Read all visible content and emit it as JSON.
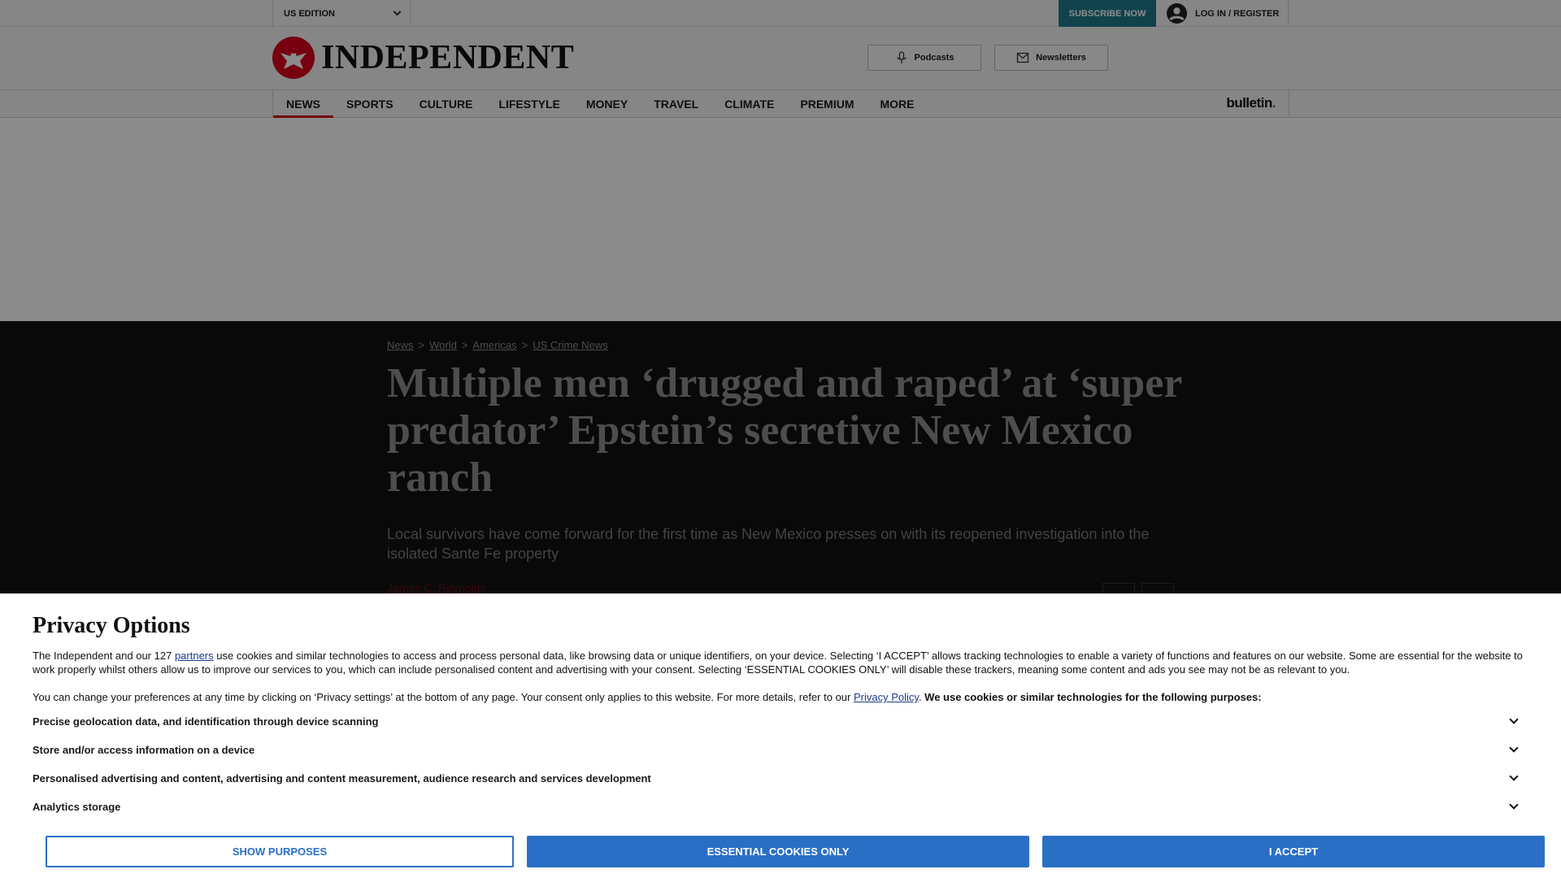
{
  "topbar": {
    "edition": "US EDITION",
    "subscribe": "SUBSCRIBE NOW",
    "login": "LOG IN / REGISTER"
  },
  "masthead": {
    "logo_text": "INDEPENDENT",
    "podcasts": "Podcasts",
    "newsletters": "Newsletters"
  },
  "nav": {
    "items": [
      "NEWS",
      "SPORTS",
      "CULTURE",
      "LIFESTYLE",
      "MONEY",
      "TRAVEL",
      "CLIMATE",
      "PREMIUM",
      "MORE"
    ],
    "active": "NEWS",
    "bulletin": "bulletin",
    "bulletin_dot": "."
  },
  "article": {
    "breadcrumbs": [
      "News",
      "World",
      "Americas",
      "US Crime News"
    ],
    "separator": ">",
    "headline": "Multiple men ‘drugged and raped’ at ‘super predator’ Epstein’s secretive New Mexico ranch",
    "standfirst": "Local survivors have come forward for the first time as New Mexico presses on with its reopened investigation into the isolated Sante Fe property",
    "author": "James C. Reynolds"
  },
  "privacy": {
    "title": "Privacy Options",
    "p1_before": "The Independent and our 127 ",
    "p1_link": "partners",
    "p1_after": " use cookies and similar technologies to access and process personal data, like browsing data or unique identifiers, on your device. Selecting ‘I ACCEPT’ allows tracking technologies to enable a variety of functions and features on our website. Some are essential for the website to work properly whilst others allow us to improve our services to you, which can include personalised content and advertising with your consent. Selecting ‘ESSENTIAL COOKIES ONLY’ will disable these trackers, meaning some content and ads you see may not be as relevant to you.",
    "p2_before": "You can change your preferences at any time by clicking on ‘Privacy settings’ at the bottom of any page. Your consent only applies to this website. For more details, refer to our ",
    "p2_link": "Privacy Policy",
    "p2_after": ". ",
    "p2_bold": "We use cookies or similar technologies for the following purposes:",
    "purposes": [
      "Precise geolocation data, and identification through device scanning",
      "Store and/or access information on a device",
      "Personalised advertising and content, advertising and content measurement, audience research and services development",
      "Analytics storage"
    ],
    "buttons": {
      "show_purposes": "SHOW PURPOSES",
      "essential": "ESSENTIAL COOKIES ONLY",
      "accept": "I ACCEPT"
    }
  },
  "colors": {
    "subscribe_bg": "#1f7b8b",
    "nav_active": "#d9001b",
    "button_blue": "#2a6fc6",
    "logo_red": "#d9001b"
  }
}
